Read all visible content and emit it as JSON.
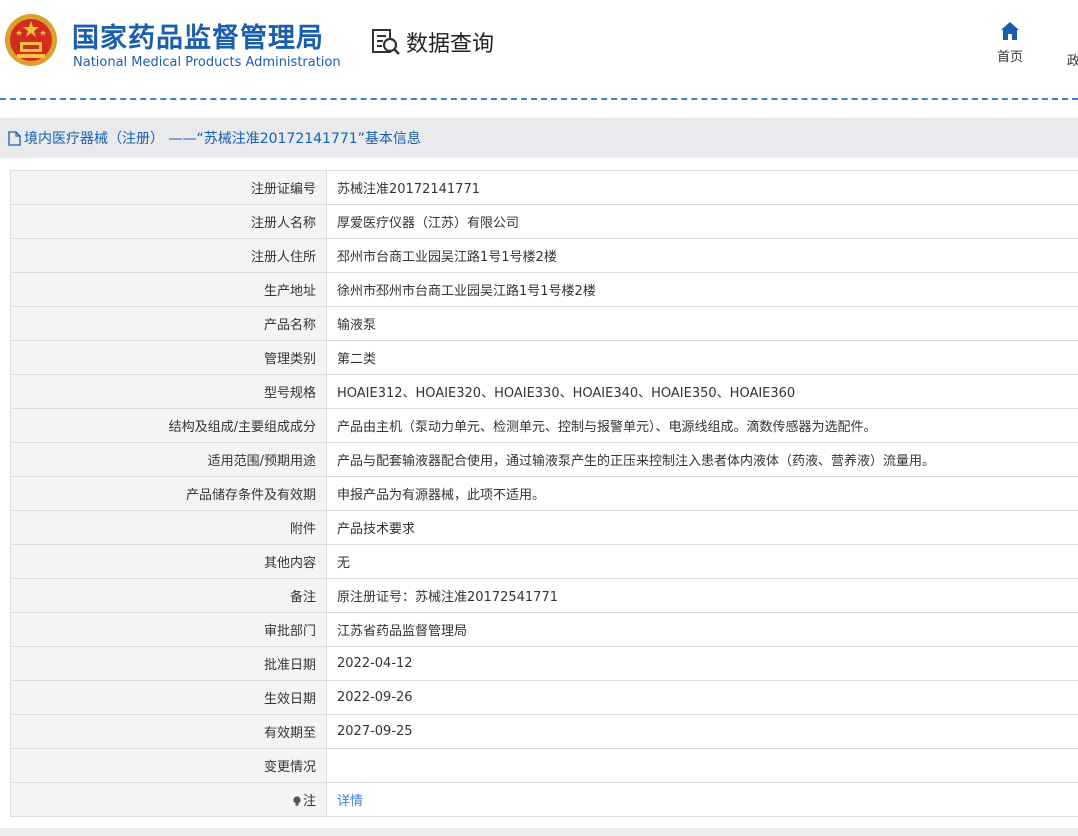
{
  "header": {
    "brand_cn": "国家药品监督管理局",
    "brand_en": "National Medical Products Administration",
    "query_label": "数据查询",
    "nav_home": "首页",
    "nav_gov": "政",
    "brand_color": "#1a5fae"
  },
  "title_bar": {
    "text": "境内医疗器械（注册） ——“苏械注准20172141771”基本信息"
  },
  "rows": [
    {
      "label": "注册证编号",
      "value": "苏械注准20172141771"
    },
    {
      "label": "注册人名称",
      "value": "厚爱医疗仪器（江苏）有限公司"
    },
    {
      "label": "注册人住所",
      "value": "邳州市台商工业园吴江路1号1号楼2楼"
    },
    {
      "label": "生产地址",
      "value": "徐州市邳州市台商工业园吴江路1号1号楼2楼"
    },
    {
      "label": "产品名称",
      "value": "输液泵"
    },
    {
      "label": "管理类别",
      "value": "第二类"
    },
    {
      "label": "型号规格",
      "value": "HOAIE312、HOAIE320、HOAIE330、HOAIE340、HOAIE350、HOAIE360"
    },
    {
      "label": "结构及组成/主要组成成分",
      "value": "产品由主机（泵动力单元、检测单元、控制与报警单元）、电源线组成。滴数传感器为选配件。"
    },
    {
      "label": "适用范围/预期用途",
      "value": "产品与配套输液器配合使用，通过输液泵产生的正压来控制注入患者体内液体（药液、营养液）流量用。"
    },
    {
      "label": "产品储存条件及有效期",
      "value": "申报产品为有源器械，此项不适用。"
    },
    {
      "label": "附件",
      "value": "产品技术要求"
    },
    {
      "label": "其他内容",
      "value": "无"
    },
    {
      "label": "备注",
      "value": "原注册证号：苏械注准20172541771"
    },
    {
      "label": "审批部门",
      "value": "江苏省药品监督管理局"
    },
    {
      "label": "批准日期",
      "value": "2022-04-12"
    },
    {
      "label": "生效日期",
      "value": "2022-09-26"
    },
    {
      "label": "有效期至",
      "value": "2027-09-25"
    },
    {
      "label": "变更情况",
      "value": ""
    }
  ],
  "note_row": {
    "label": "注",
    "icon": "bulb-icon",
    "link": "详情"
  }
}
